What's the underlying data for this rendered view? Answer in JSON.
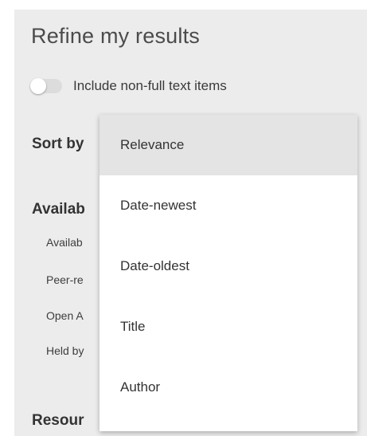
{
  "panel": {
    "title": "Refine my results",
    "toggle": {
      "label": "Include non-full text items",
      "state": "off"
    },
    "sort_heading": "Sort by",
    "availability_heading": "Availab",
    "availability_items": [
      "Availab",
      "Peer-re",
      "Open A",
      "Held by"
    ],
    "resource_heading": "Resour"
  },
  "sort_dropdown": {
    "selected": "Relevance",
    "options": [
      "Relevance",
      "Date-newest",
      "Date-oldest",
      "Title",
      "Author"
    ]
  }
}
